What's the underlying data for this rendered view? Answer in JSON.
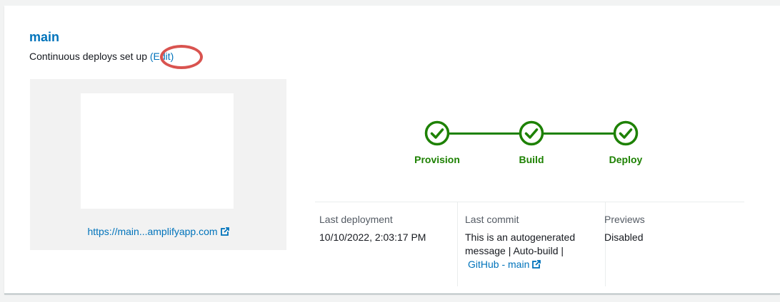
{
  "branch": {
    "name": "main",
    "continuous_deploys_text": "Continuous deploys set up",
    "edit_label": "(Edit)"
  },
  "preview": {
    "url": "https://main...amplifyapp.com"
  },
  "pipeline": {
    "steps": [
      {
        "label": "Provision",
        "status": "complete"
      },
      {
        "label": "Build",
        "status": "complete"
      },
      {
        "label": "Deploy",
        "status": "complete"
      }
    ]
  },
  "details": {
    "last_deployment": {
      "label": "Last deployment",
      "value": "10/10/2022, 2:03:17 PM"
    },
    "last_commit": {
      "label": "Last commit",
      "line1": "This is an autogenerated",
      "line2": "message | Auto-build |",
      "link": "GitHub - main"
    },
    "previews": {
      "label": "Previews",
      "value": "Disabled"
    }
  },
  "colors": {
    "link": "#0073bb",
    "success": "#1d8102",
    "highlight_ring": "#d9534f",
    "panel_bg": "#f2f2f2"
  },
  "icons": {
    "external_link": "external-link-icon",
    "step_complete": "check-circle-icon"
  }
}
